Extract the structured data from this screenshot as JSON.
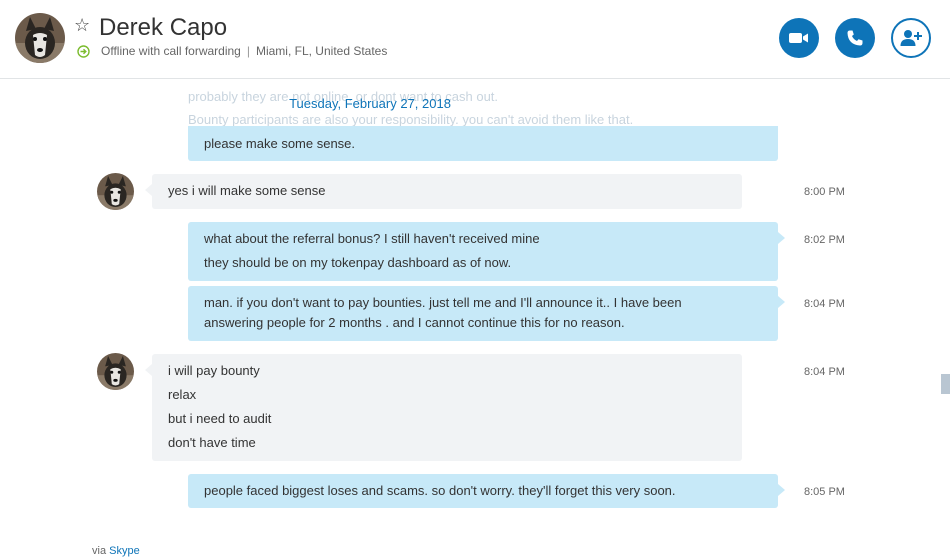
{
  "contact": {
    "name": "Derek Capo",
    "status": "Offline with call forwarding",
    "location": "Miami, FL, United States",
    "separator": "|"
  },
  "icons": {
    "favorite": "star-outline-icon",
    "status": "call-forwarding-icon",
    "video": "video-camera-icon",
    "call": "phone-icon",
    "add_person": "add-person-icon"
  },
  "colors": {
    "accent": "#0e74b8",
    "outgoing_bubble": "#c7e9f8",
    "incoming_bubble": "#f1f3f5",
    "status_green": "#7cbc2f"
  },
  "faded_lines": [
    "probably they are not online. or dont want to cash out.",
    "Bounty participants are also your responsibility. you can't avoid them like that."
  ],
  "date_separator": "Tuesday, February 27, 2018",
  "messages": [
    {
      "direction": "out",
      "lines": [
        "please make some sense."
      ],
      "time": ""
    },
    {
      "direction": "in",
      "lines": [
        "yes i will make some sense"
      ],
      "time": "8:00 PM"
    },
    {
      "direction": "out",
      "lines": [
        "what about the referral bonus? I still haven't received mine",
        "they should be on my tokenpay dashboard as of now."
      ],
      "time": "8:02 PM"
    },
    {
      "direction": "out",
      "lines": [
        "man. if you don't want to pay bounties. just tell me and I'll announce it.. I have been",
        "answering people for 2 months . and I cannot continue this for no reason."
      ],
      "time": "8:04 PM"
    },
    {
      "direction": "in",
      "lines": [
        "i will pay bounty",
        "relax",
        "but i need to audit",
        "don't have time"
      ],
      "time": "8:04 PM"
    },
    {
      "direction": "out",
      "lines": [
        "people faced biggest loses and scams. so don't worry. they'll forget this very soon."
      ],
      "time": "8:05 PM"
    }
  ],
  "footer": {
    "via": "via",
    "link": "Skype"
  }
}
